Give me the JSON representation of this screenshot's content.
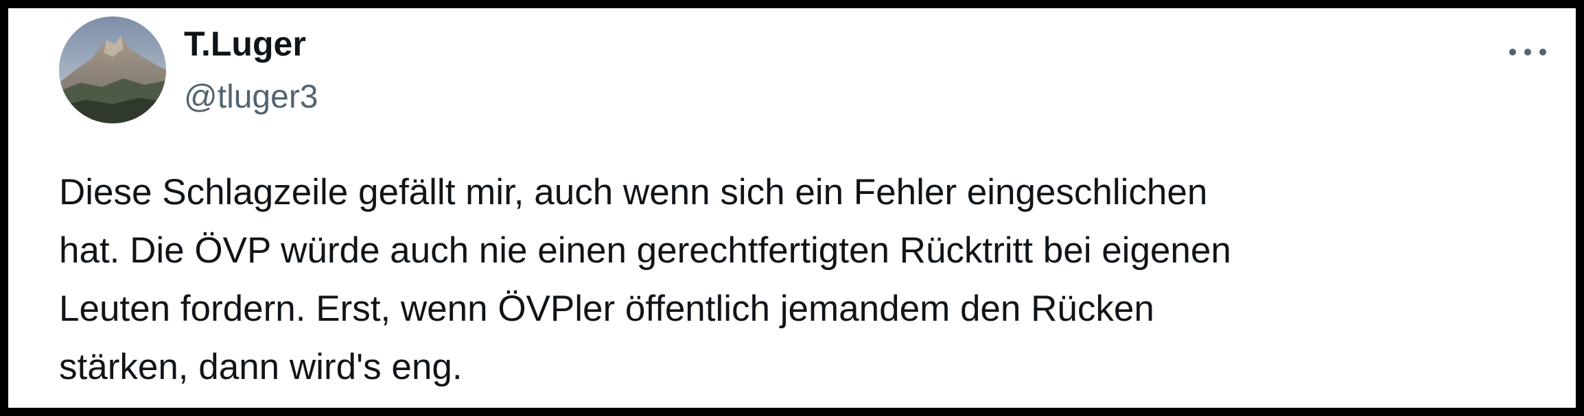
{
  "tweet": {
    "author": {
      "display_name": "T.Luger",
      "handle": "@tluger3",
      "avatar_icon": "mountain-avatar-icon"
    },
    "more_icon": "more-horizontal-icon",
    "text_lines": [
      "Diese Schlagzeile gefällt mir, auch wenn sich ein Fehler eingeschlichen",
      "hat. Die ÖVP würde auch nie einen gerechtfertigten Rücktritt bei eigenen",
      "Leuten fordern. Erst, wenn ÖVPler öffentlich jemandem den Rücken",
      "stärken, dann wird's eng."
    ]
  },
  "colors": {
    "text_primary": "#0f1419",
    "text_secondary": "#536471",
    "frame_border": "#000000",
    "background": "#ffffff"
  }
}
